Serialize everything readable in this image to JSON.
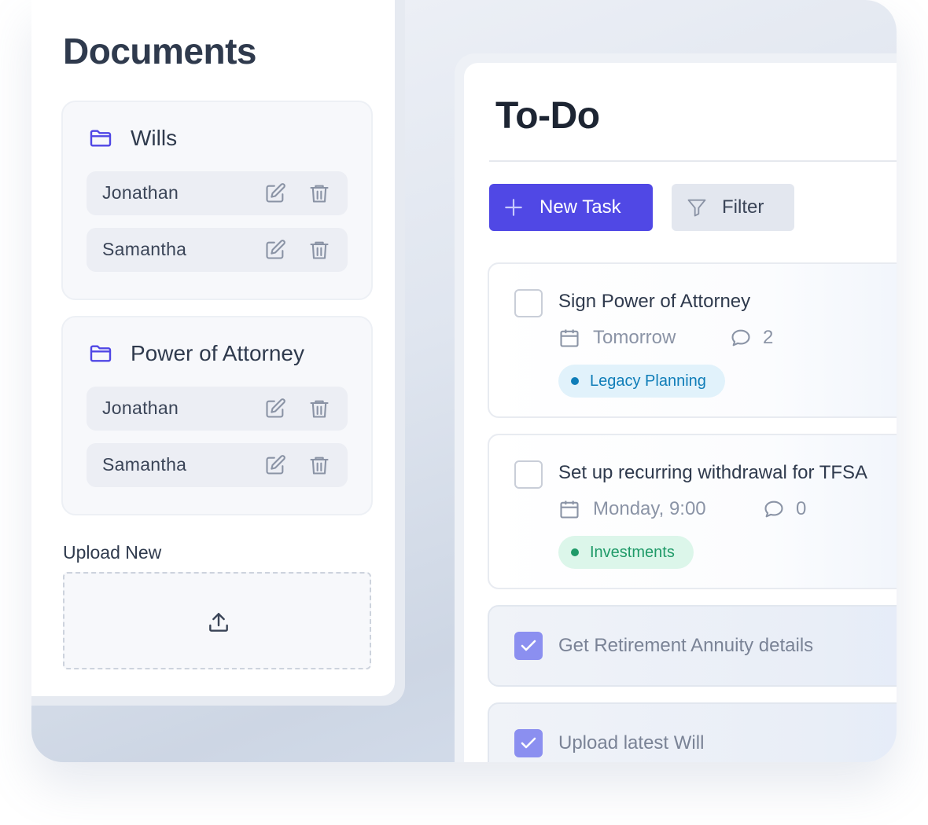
{
  "documents": {
    "title": "Documents",
    "folders": [
      {
        "name": "Wills",
        "files": [
          "Jonathan",
          "Samantha"
        ]
      },
      {
        "name": "Power of Attorney",
        "files": [
          "Jonathan",
          "Samantha"
        ]
      }
    ],
    "upload_label": "Upload New"
  },
  "todo": {
    "title": "To-Do",
    "new_task_label": "New Task",
    "filter_label": "Filter",
    "tasks": [
      {
        "title": "Sign Power of Attorney",
        "date": "Tomorrow",
        "comments": "2",
        "tag": "Legacy Planning",
        "done": false
      },
      {
        "title": "Set up recurring withdrawal for TFSA",
        "date": "Monday, 9:00",
        "comments": "0",
        "tag": "Investments",
        "done": false
      },
      {
        "title": "Get Retirement Annuity details",
        "done": true
      },
      {
        "title": "Upload latest Will",
        "done": true
      }
    ]
  },
  "colors": {
    "accent": "#5048e5",
    "folder_icon": "#4f46e5",
    "checked": "#8b8ff0",
    "tag_blue": "#0f7db8",
    "tag_green": "#1f9a68"
  }
}
